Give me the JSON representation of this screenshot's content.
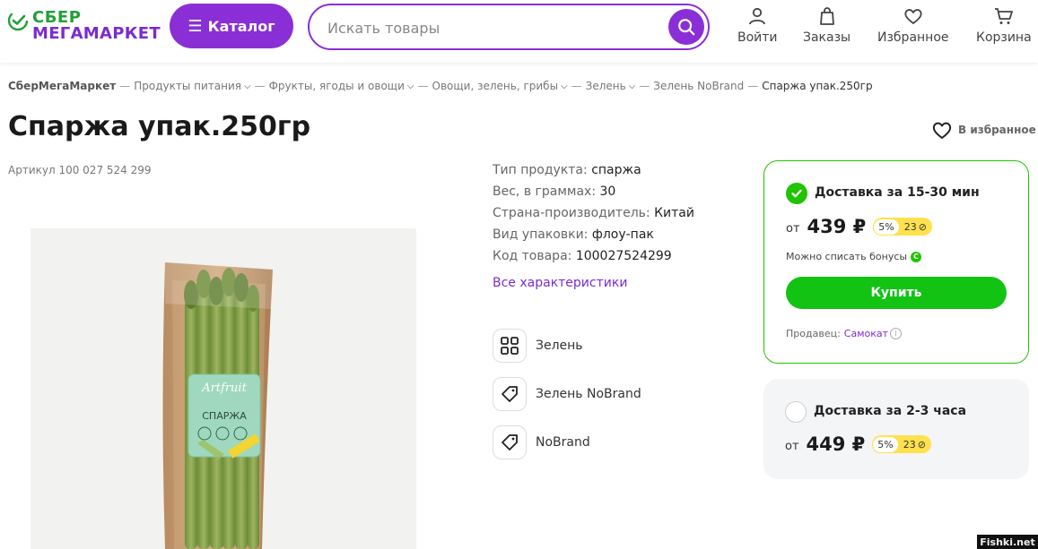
{
  "header": {
    "logo_line1": "СБЕР",
    "logo_line2": "МЕГАМАРКЕТ",
    "catalog_label": "Каталог",
    "search_placeholder": "Искать товары",
    "nav": {
      "login": "Войти",
      "orders": "Заказы",
      "favorites": "Избранное",
      "cart": "Корзина"
    }
  },
  "breadcrumb": {
    "items": [
      "СберМегаМаркет",
      "Продукты питания",
      "Фрукты, ягоды и овощи",
      "Овощи, зелень, грибы",
      "Зелень",
      "Зелень NoBrand",
      "Спаржа упак.250гр"
    ],
    "separator": "—"
  },
  "product": {
    "title": "Спаржа упак.250гр",
    "favorite_label": "В избранное",
    "article": "Артикул 100 027 524 299",
    "package_brand": "Artfruit",
    "package_label": "СПАРЖА",
    "specs": [
      {
        "label": "Тип продукта:",
        "value": "спаржа"
      },
      {
        "label": "Вес, в граммах:",
        "value": "30"
      },
      {
        "label": "Страна-производитель:",
        "value": "Китай"
      },
      {
        "label": "Вид упаковки:",
        "value": "флоу-пак"
      },
      {
        "label": "Код товара:",
        "value": "100027524299"
      }
    ],
    "all_specs_label": "Все характеристики",
    "tags": [
      {
        "label": "Зелень",
        "icon": "grid-icon"
      },
      {
        "label": "Зелень NoBrand",
        "icon": "tag-icon"
      },
      {
        "label": "NoBrand",
        "icon": "tag-icon"
      }
    ]
  },
  "offers": [
    {
      "delivery": "Доставка за 15-30 мин",
      "selected": true,
      "price_prefix": "от",
      "price": "439 ₽",
      "bonus_percent": "5%",
      "bonus_points": "23",
      "writeoff_text": "Можно списать бонусы",
      "buy_label": "Купить",
      "seller_label": "Продавец:",
      "seller_name": "Самокат"
    },
    {
      "delivery": "Доставка за 2-3 часа",
      "selected": false,
      "price_prefix": "от",
      "price": "449 ₽",
      "bonus_percent": "5%",
      "bonus_points": "23"
    }
  ],
  "colors": {
    "brand_purple": "#8a2fd6",
    "brand_green": "#21a038",
    "buy_green": "#12c314",
    "bonus_yellow": "#ffe14d"
  },
  "watermark": "Fishki.net"
}
